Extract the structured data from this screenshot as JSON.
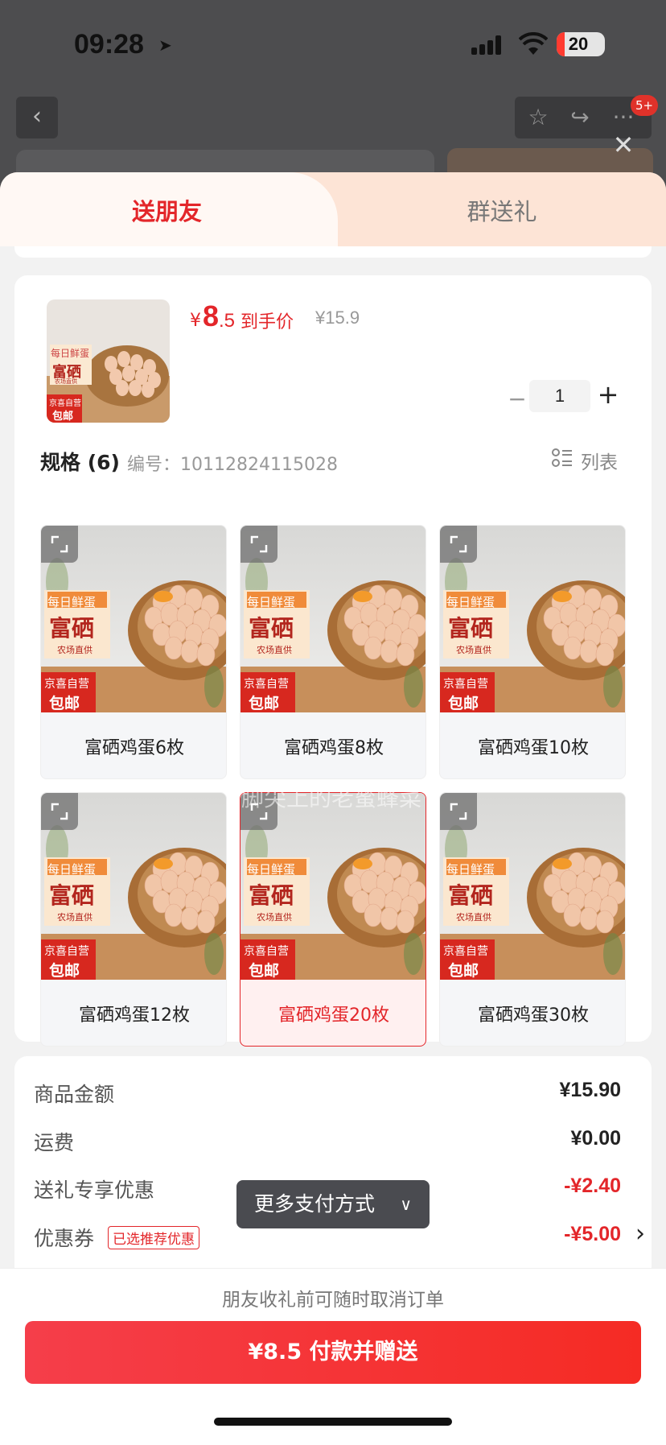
{
  "status_bar": {
    "time": "09:28",
    "battery": "20",
    "badge": "5+"
  },
  "tabs": {
    "active": "送朋友",
    "inactive": "群送礼"
  },
  "product": {
    "currency": "¥",
    "price_int": "8",
    "price_dec": ".5",
    "price_label": "到手价",
    "original_price": "¥15.9",
    "quantity": "1",
    "thumb_texts": {
      "line1": "每日鲜蛋",
      "line2": "富硒",
      "line3": "农场直供",
      "tag1": "京喜自营",
      "tag2": "包邮"
    }
  },
  "spec": {
    "title": "规格 (6)",
    "code": "编号：10112824115028",
    "list_label": "列表",
    "items": [
      {
        "label": "富硒鸡蛋6枚",
        "selected": false
      },
      {
        "label": "富硒鸡蛋8枚",
        "selected": false
      },
      {
        "label": "富硒鸡蛋10枚",
        "selected": false
      },
      {
        "label": "富硒鸡蛋12枚",
        "selected": false
      },
      {
        "label": "富硒鸡蛋20枚",
        "selected": true
      },
      {
        "label": "富硒鸡蛋30枚",
        "selected": false
      }
    ],
    "watermark": "脚尖上的老蜜蜂菜"
  },
  "summary": {
    "goods_label": "商品金额",
    "goods_value": "¥15.90",
    "shipping_label": "运费",
    "shipping_value": "¥0.00",
    "gift_label": "送礼专享优惠",
    "gift_value": "-¥2.40",
    "coupon_label": "优惠券",
    "coupon_tag": "已选推荐优惠",
    "coupon_value": "-¥5.00"
  },
  "more_pay": "更多支付方式",
  "bottom": {
    "cancel_note": "朋友收礼前可随时取消订单",
    "pay_button": "¥8.5 付款并赠送"
  },
  "colors": {
    "accent": "#e3262a",
    "tab_bg": "#fde4d6",
    "pay_gradient_start": "#f53e4a",
    "pay_gradient_end": "#f52b24"
  }
}
